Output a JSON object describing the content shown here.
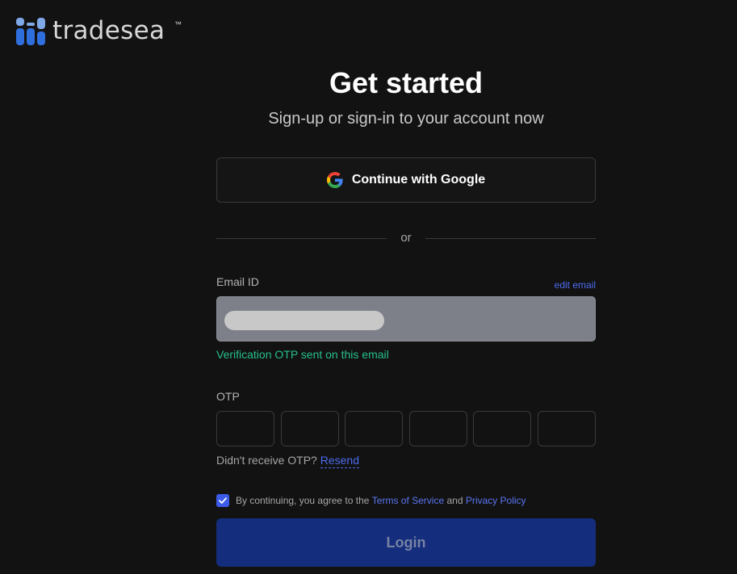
{
  "brand": {
    "name": "tradesea",
    "trademark": "™",
    "colors": {
      "mark_light": "#7fa8e8",
      "mark_dark": "#2f6fdd"
    }
  },
  "auth": {
    "title": "Get started",
    "subtitle": "Sign-up or sign-in to your account now",
    "google_button_label": "Continue with Google",
    "divider_text": "or",
    "email": {
      "label": "Email ID",
      "edit_link": "edit email",
      "value": "",
      "status_message": "Verification OTP sent on this email"
    },
    "otp": {
      "label": "OTP",
      "digits": [
        "",
        "",
        "",
        "",
        "",
        ""
      ],
      "resend_prompt": "Didn't receive OTP?",
      "resend_link": "Resend"
    },
    "terms": {
      "checked": true,
      "prefix": "By continuing, you agree to the ",
      "terms_link": "Terms of Service",
      "conjunction": " and ",
      "privacy_link": "Privacy Policy"
    },
    "login_button_label": "Login"
  },
  "colors": {
    "background": "#121212",
    "accent": "#4d6cf0",
    "success": "#27c08a",
    "login_button": "#142d7c"
  },
  "icons": {
    "logo": "tradesea-logo-icon",
    "google": "google-icon",
    "checkbox": "checkmark-icon"
  }
}
